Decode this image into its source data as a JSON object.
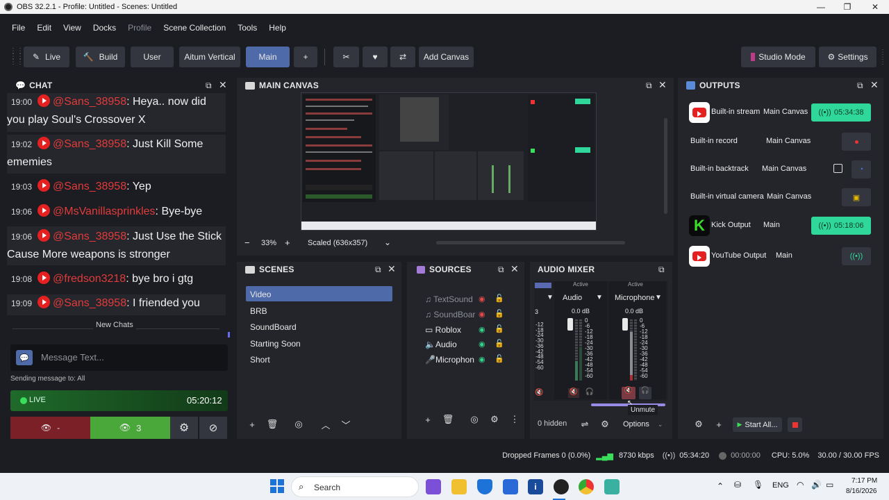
{
  "window": {
    "title": "OBS 32.2.1 - Profile: Untitled - Scenes: Untitled"
  },
  "menu": [
    "File",
    "Edit",
    "View",
    "Docks",
    "Profile",
    "Scene Collection",
    "Tools",
    "Help"
  ],
  "toolbar": {
    "live": "Live",
    "build": "Build",
    "user": "User",
    "aitum": "Aitum Vertical",
    "main": "Main",
    "add": "+",
    "add_canvas": "Add Canvas",
    "studio_mode": "Studio Mode",
    "settings": "Settings"
  },
  "chat": {
    "title": "CHAT",
    "messages": [
      {
        "time": "19:00",
        "user": "@Sans_38958",
        "text": ": Heya.. now did you play Soul's Crossover X"
      },
      {
        "time": "19:02",
        "user": "@Sans_38958",
        "text": ": Just Kill Some ememies"
      },
      {
        "time": "19:03",
        "user": "@Sans_38958",
        "text": ": Yep"
      },
      {
        "time": "19:06",
        "user": "@MsVanillasprinkles",
        "text": ": Bye-bye"
      },
      {
        "time": "19:06",
        "user": "@Sans_38958",
        "text": ": Just Use the Stick Cause More weapons is stronger"
      },
      {
        "time": "19:08",
        "user": "@fredson3218",
        "text": ": bye bro i gtg"
      },
      {
        "time": "19:09",
        "user": "@Sans_38958",
        "text": ": I friended you"
      }
    ],
    "new_chats": "New Chats",
    "input_placeholder": "Message Text...",
    "sending_to": "Sending message to: All",
    "live_label": "LIVE",
    "live_time": "05:20:12",
    "viewers_left": "-",
    "viewers_right": "3"
  },
  "canvas": {
    "title": "MAIN CANVAS",
    "zoom_minus": "−",
    "zoom": "33%",
    "zoom_plus": "+",
    "scaled": "Scaled (636x357)"
  },
  "scenes": {
    "title": "SCENES",
    "items": [
      "Video",
      "BRB",
      "SoundBoard",
      "Starting Soon",
      "Short"
    ],
    "selected": "Video"
  },
  "sources": {
    "title": "SOURCES",
    "items": [
      {
        "name": "TextSound",
        "visible": false
      },
      {
        "name": "SoundBoar",
        "visible": false
      },
      {
        "name": "Roblox",
        "visible": true
      },
      {
        "name": "Audio",
        "visible": true
      },
      {
        "name": "Microphon",
        "visible": true
      }
    ]
  },
  "mixer": {
    "title": "AUDIO MIXER",
    "channels": [
      {
        "name": "Audio",
        "status": "Active",
        "db": "0.0 dB"
      },
      {
        "name": "Microphone",
        "status": "Active",
        "db": "0.0 dB"
      }
    ],
    "partial_db": "3",
    "scale": [
      "0",
      "-6",
      "-12",
      "-18",
      "-24",
      "-30",
      "-36",
      "-42",
      "-48",
      "-54",
      "-60"
    ],
    "hidden": "0 hidden",
    "options": "Options",
    "tooltip": "Unmute"
  },
  "outputs": {
    "title": "OUTPUTS",
    "rows": [
      {
        "name": "Built-in stream",
        "canvas": "Main Canvas",
        "time": "05:34:38",
        "icon": "youtube-icon"
      },
      {
        "name": "Built-in record",
        "canvas": "Main Canvas",
        "time": "",
        "icon": ""
      },
      {
        "name": "Built-in backtrack",
        "canvas": "Main Canvas",
        "time": "",
        "icon": ""
      },
      {
        "name": "Built-in virtual camera",
        "canvas": "Main Canvas",
        "time": "",
        "icon": ""
      },
      {
        "name": "Kick Output",
        "canvas": "Main",
        "time": "05:18:06",
        "icon": "kick-icon"
      },
      {
        "name": "YouTube Output",
        "canvas": "Main",
        "time": "",
        "icon": "youtube-icon"
      }
    ],
    "start_all": "Start All..."
  },
  "status": {
    "dropped": "Dropped Frames 0 (0.0%)",
    "kbps": "8730 kbps",
    "stream_time": "05:34:20",
    "rec_time": "00:00:00",
    "cpu": "CPU: 5.0%",
    "fps": "30.00 / 30.00 FPS"
  },
  "taskbar": {
    "search": "Search",
    "lang": "ENG",
    "time": "7:17 PM",
    "date": "8/16/2026"
  },
  "colors": {
    "accent": "#4f6aa8",
    "live_green": "#2fd89a",
    "youtube_red": "#e52020"
  }
}
